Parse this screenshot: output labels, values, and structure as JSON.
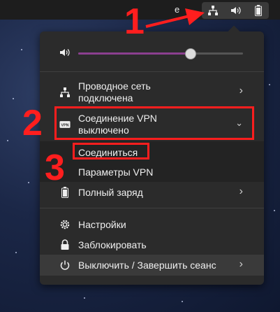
{
  "topbar": {
    "clipped_text": "e",
    "tray_icons": [
      "network-wired-icon",
      "volume-icon",
      "battery-icon"
    ]
  },
  "volume": {
    "level": 0.68,
    "icon": "volume-icon"
  },
  "menu": {
    "wired": {
      "label": "Проводное сеть\nподключена",
      "icon": "network-wired-icon"
    },
    "vpn": {
      "label": "Соединение VPN\nвыключено",
      "icon": "vpn-icon",
      "expanded": true,
      "submenu": [
        {
          "label": "Соединиться"
        },
        {
          "label": "Параметры VPN"
        }
      ]
    },
    "battery": {
      "label": "Полный заряд",
      "icon": "battery-icon"
    },
    "settings": {
      "label": "Настройки",
      "icon": "gear-icon"
    },
    "lock": {
      "label": "Заблокировать",
      "icon": "lock-icon"
    },
    "power": {
      "label": "Выключить / Завершить сеанс",
      "icon": "power-icon"
    }
  },
  "annotations": {
    "n1": "1",
    "n2": "2",
    "n3": "3"
  },
  "colors": {
    "annotation": "#ff1e1e",
    "slider_fill": "#8b3f8f",
    "menu_bg": "#2b2b2b"
  }
}
